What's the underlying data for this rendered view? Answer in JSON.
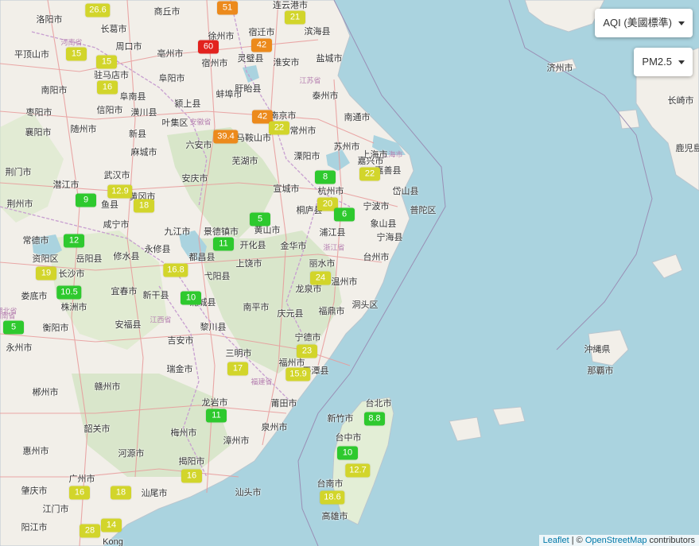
{
  "controls": {
    "metric_label": "AQI (美國標準)",
    "pollutant_label": "PM2.5"
  },
  "attribution": {
    "leaflet": "Leaflet",
    "separator": " | © ",
    "osm": "OpenStreetMap",
    "contributors": " contributors"
  },
  "colors": {
    "good": "#2ec92e",
    "moderate": "#d2d52b",
    "usg": "#ec8a1c",
    "unhealthy": "#e2221e"
  },
  "stations": [
    {
      "value": "26.6",
      "level": "moderate"
    },
    {
      "value": "51",
      "level": "usg"
    },
    {
      "value": "21",
      "level": "moderate"
    },
    {
      "value": "60",
      "level": "unhealthy"
    },
    {
      "value": "42",
      "level": "usg"
    },
    {
      "value": "15",
      "level": "moderate"
    },
    {
      "value": "15",
      "level": "moderate"
    },
    {
      "value": "16",
      "level": "moderate"
    },
    {
      "value": "42",
      "level": "usg"
    },
    {
      "value": "22",
      "level": "moderate"
    },
    {
      "value": "39.4",
      "level": "usg"
    },
    {
      "value": "8",
      "level": "good"
    },
    {
      "value": "22",
      "level": "moderate"
    },
    {
      "value": "9",
      "level": "good"
    },
    {
      "value": "12.9",
      "level": "moderate"
    },
    {
      "value": "18",
      "level": "moderate"
    },
    {
      "value": "20",
      "level": "moderate"
    },
    {
      "value": "6",
      "level": "good"
    },
    {
      "value": "5",
      "level": "good"
    },
    {
      "value": "12",
      "level": "good"
    },
    {
      "value": "11",
      "level": "good"
    },
    {
      "value": "19",
      "level": "moderate"
    },
    {
      "value": "16.8",
      "level": "moderate"
    },
    {
      "value": "24",
      "level": "moderate"
    },
    {
      "value": "10.5",
      "level": "good"
    },
    {
      "value": "10",
      "level": "good"
    },
    {
      "value": "5",
      "level": "good"
    },
    {
      "value": "23",
      "level": "moderate"
    },
    {
      "value": "17",
      "level": "moderate"
    },
    {
      "value": "15.9",
      "level": "moderate"
    },
    {
      "value": "8.8",
      "level": "good"
    },
    {
      "value": "11",
      "level": "good"
    },
    {
      "value": "10",
      "level": "good"
    },
    {
      "value": "12.7",
      "level": "moderate"
    },
    {
      "value": "16",
      "level": "moderate"
    },
    {
      "value": "18.6",
      "level": "moderate"
    },
    {
      "value": "16",
      "level": "moderate"
    },
    {
      "value": "18",
      "level": "moderate"
    },
    {
      "value": "14",
      "level": "moderate"
    },
    {
      "value": "28",
      "level": "moderate"
    }
  ],
  "cities": [
    "洛阳市",
    "商丘市",
    "连云港市",
    "滨海县",
    "长葛市",
    "宿迁市",
    "徐州市",
    "周口市",
    "亳州市",
    "宿州市",
    "灵璧县",
    "淮安市",
    "盐城市",
    "平顶山市",
    "驻马店市",
    "阜阳市",
    "阜南县",
    "蚌埠市",
    "盱眙县",
    "泰州市",
    "南阳市",
    "枣阳市",
    "信阳市",
    "潢川县",
    "颍上县",
    "南京市",
    "南通市",
    "随州市",
    "叶集区",
    "六安市",
    "马鞍山市",
    "常州市",
    "苏州市",
    "上海市",
    "襄阳市",
    "新县",
    "麻城市",
    "芜湖市",
    "溧阳市",
    "嘉兴市",
    "荆门市",
    "潜江市",
    "武汉市",
    "黄冈市",
    "安庆市",
    "宣城市",
    "杭州市",
    "嘉善县",
    "岱山县",
    "荆州市",
    "鱼县",
    "咸宁市",
    "黄山市",
    "桐庐县",
    "宁波市",
    "普陀区",
    "常德市",
    "九江市",
    "景德镇市",
    "浦江县",
    "象山县",
    "资阳区",
    "岳阳县",
    "修水县",
    "永修县",
    "开化县",
    "金华市",
    "宁海县",
    "都昌县",
    "上饶市",
    "丽水市",
    "台州市",
    "长沙市",
    "宜春市",
    "弋阳县",
    "温州市",
    "娄底市",
    "株洲市",
    "新干县",
    "浦城县",
    "龙泉市",
    "洞头区",
    "衡阳市",
    "安福县",
    "黎川县",
    "南平市",
    "庆元县",
    "福鼎市",
    "永州市",
    "吉安市",
    "宁德市",
    "三明市",
    "福州市",
    "平潭县",
    "赣州市",
    "瑞金市",
    "龙岩市",
    "莆田市",
    "郴州市",
    "梅州市",
    "泉州市",
    "漳州市",
    "台北市",
    "新竹市",
    "韶关市",
    "河源市",
    "揭阳市",
    "汕头市",
    "台中市",
    "广州市",
    "惠州市",
    "汕尾市",
    "台南市",
    "肇庆市",
    "江门市",
    "高雄市",
    "阳江市",
    "Kong",
    "济州市",
    "长崎市",
    "鹿児島",
    "沖縄県",
    "那覇市",
    "湖北省",
    "河南省",
    "安徽省",
    "江苏省",
    "浙江省",
    "江西省",
    "湖南省",
    "福建省",
    "上海市"
  ]
}
